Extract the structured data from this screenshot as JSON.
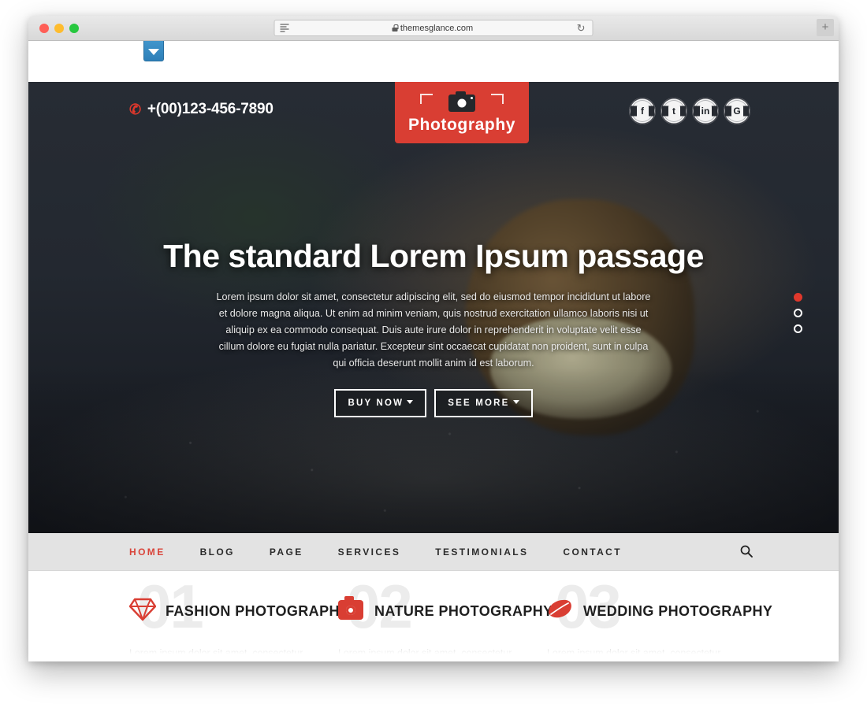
{
  "browser": {
    "url": "themesglance.com",
    "reload_label": "↻",
    "newtab_label": "+",
    "traffic_lights": [
      "close",
      "minimize",
      "zoom"
    ]
  },
  "site": {
    "phone": "+(00)123-456-7890",
    "logo_text": "Photography",
    "socials": [
      {
        "name": "facebook",
        "glyph": "f"
      },
      {
        "name": "twitter",
        "glyph": "t"
      },
      {
        "name": "linkedin",
        "glyph": "in"
      },
      {
        "name": "googleplus",
        "glyph": "G"
      }
    ],
    "accent_red": "#d93e33",
    "nav_active_red": "#d9443a"
  },
  "hero": {
    "title": "The standard Lorem Ipsum passage",
    "paragraph": "Lorem ipsum dolor sit amet, consectetur adipiscing elit, sed do eiusmod tempor incididunt ut labore et dolore magna aliqua. Ut enim ad minim veniam, quis nostrud exercitation ullamco laboris nisi ut aliquip ex ea commodo consequat. Duis aute irure dolor in reprehenderit in voluptate velit esse cillum dolore eu fugiat nulla pariatur. Excepteur sint occaecat cupidatat non proident, sunt in culpa qui officia deserunt mollit anim id est laborum.",
    "buttons": [
      {
        "label": "BUY NOW"
      },
      {
        "label": "SEE MORE"
      }
    ],
    "slider_dots": [
      {
        "state": "active"
      },
      {
        "state": "idle"
      },
      {
        "state": "idle"
      }
    ]
  },
  "nav": {
    "items": [
      {
        "label": "HOME",
        "active": true
      },
      {
        "label": "BLOG",
        "active": false
      },
      {
        "label": "PAGE",
        "active": false
      },
      {
        "label": "SERVICES",
        "active": false
      },
      {
        "label": "TESTIMONIALS",
        "active": false
      },
      {
        "label": "CONTACT",
        "active": false
      }
    ],
    "search_icon": "search-icon"
  },
  "services": [
    {
      "number": "01",
      "title": "FASHION PHOTOGRAPHY",
      "icon": "diamond-icon",
      "desc": "Lorem ipsum dolor sit amet, consectetur adipiscing elit, sed do eiusmod tempor incididunt ut labore et"
    },
    {
      "number": "02",
      "title": "NATURE PHOTOGRAPHY",
      "icon": "camera-icon",
      "desc": "Lorem ipsum dolor sit amet, consectetur adipiscing elit, sed do eiusmod tempor incididunt ut labore et"
    },
    {
      "number": "03",
      "title": "WEDDING PHOTOGRAPHY",
      "icon": "leaf-icon",
      "desc": "Lorem ipsum dolor sit amet, consectetur adipiscing elit, sed do eiusmod tempor incididunt ut labore et"
    }
  ]
}
